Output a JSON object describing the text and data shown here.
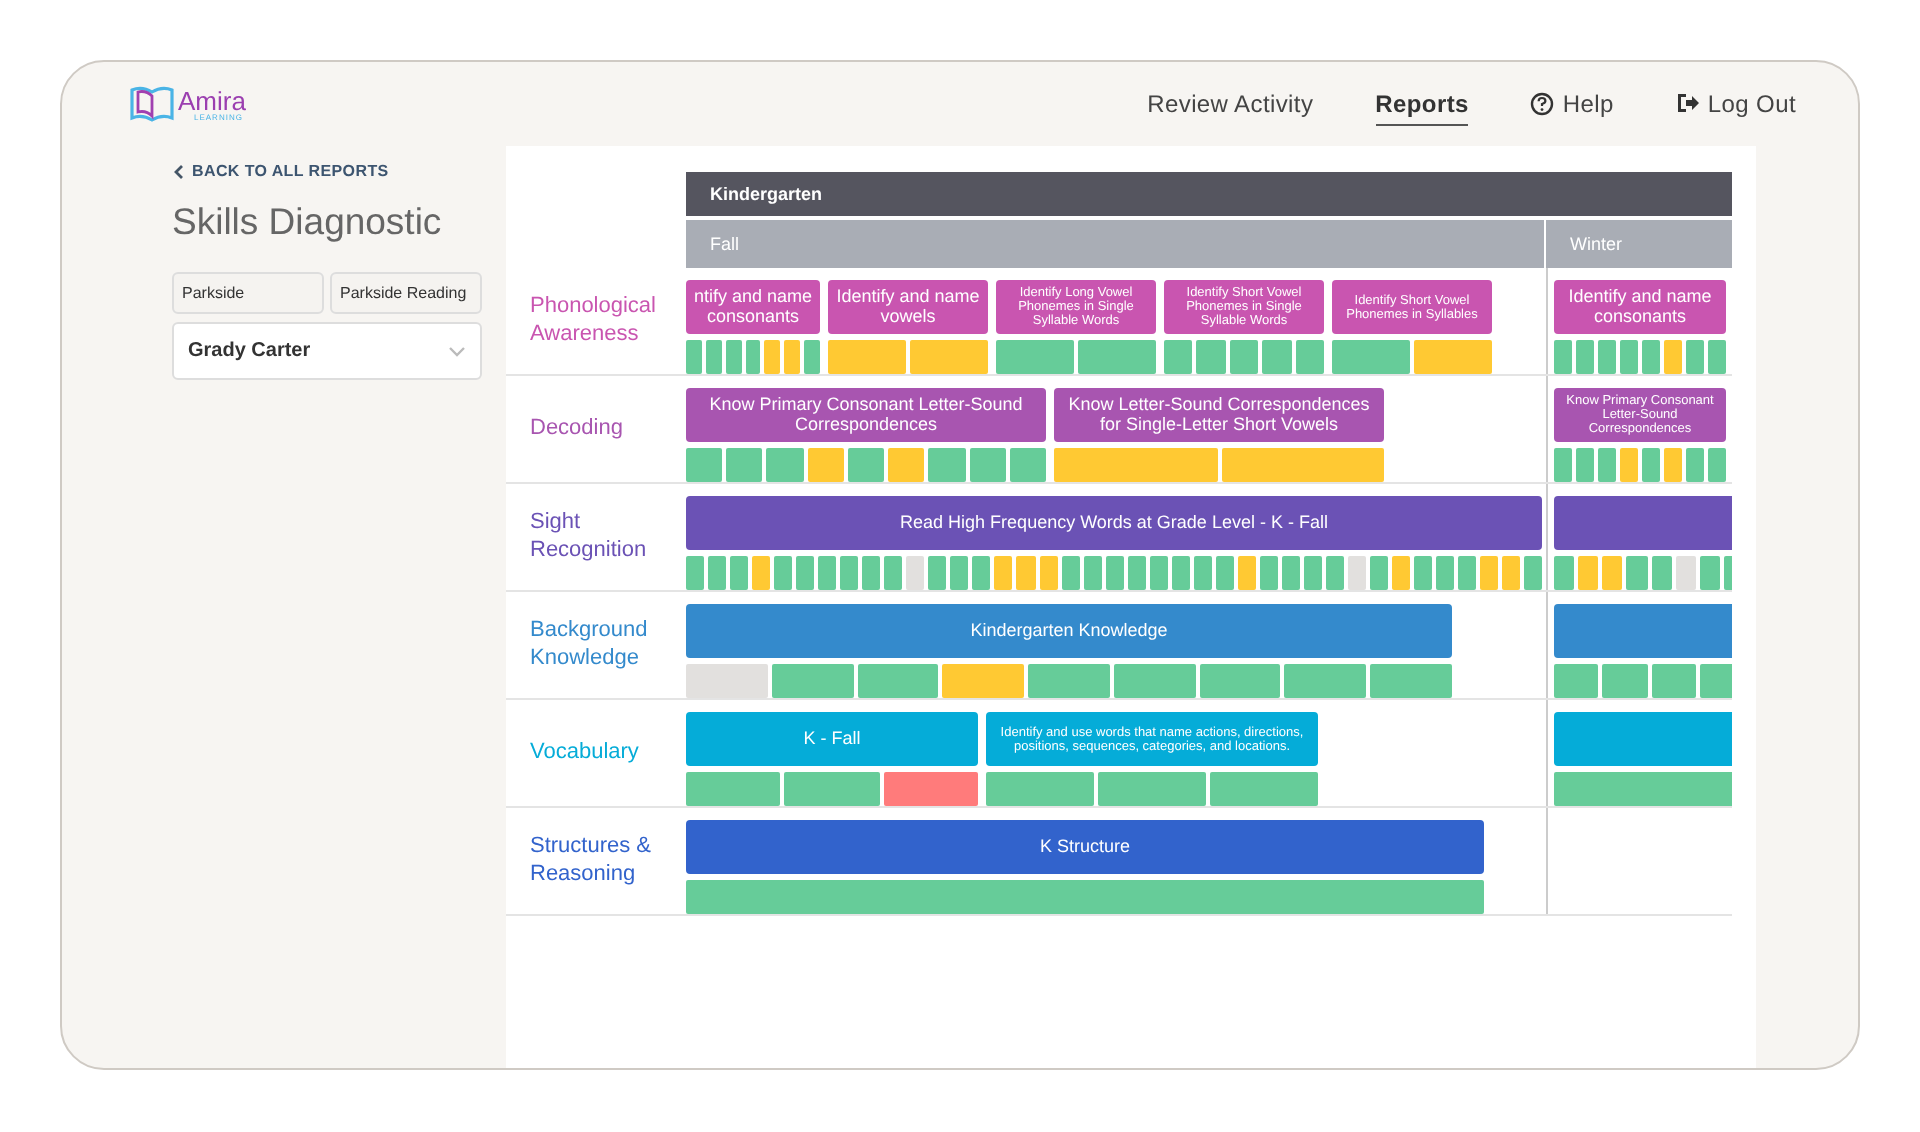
{
  "header": {
    "logo": {
      "name": "Amira",
      "tagline": "LEARNING"
    },
    "nav": [
      {
        "label": "Review Activity",
        "selected": false
      },
      {
        "label": "Reports",
        "selected": true
      },
      {
        "label": "Help",
        "selected": false,
        "kind": "help"
      },
      {
        "label": "Log Out",
        "selected": false,
        "kind": "logout"
      }
    ]
  },
  "sidebar": {
    "back_link": "BACK TO ALL REPORTS",
    "title": "Skills Diagnostic",
    "filters": [
      "Parkside",
      "Parkside Reading"
    ],
    "student_select": {
      "value": "Grady Carter"
    }
  },
  "report": {
    "grade": "Kindergarten",
    "terms": [
      "Fall",
      "Winter"
    ],
    "rows": [
      {
        "label": "Phonological Awareness",
        "color": "#c955b0",
        "fall": [
          {
            "skill": "ntify and name consonants",
            "cells": [
              {
                "kind": "mastered"
              },
              {
                "kind": "mastered"
              },
              {
                "kind": "mastered"
              },
              {
                "kind": "mastered"
              },
              {
                "kind": "developing"
              },
              {
                "kind": "developing"
              },
              {
                "kind": "mastered"
              }
            ]
          },
          {
            "skill": "Identify and name vowels",
            "cells": [
              {
                "kind": "developing"
              },
              {
                "kind": "developing"
              }
            ]
          },
          {
            "skill": "Identify Long Vowel Phonemes in Single Syllable Words",
            "cells": [
              {
                "kind": "mastered"
              },
              {
                "kind": "mastered"
              }
            ]
          },
          {
            "skill": "Identify Short Vowel Phonemes in Single Syllable Words",
            "cells": [
              {
                "kind": "mastered"
              },
              {
                "kind": "mastered"
              },
              {
                "kind": "mastered"
              },
              {
                "kind": "mastered"
              },
              {
                "kind": "mastered"
              }
            ]
          },
          {
            "skill": "Identify Short Vowel Phonemes in Syllables",
            "cells": [
              {
                "kind": "mastered"
              },
              {
                "kind": "developing"
              }
            ]
          }
        ],
        "winter": [
          {
            "skill": "Identify and name consonants",
            "cells": [
              {
                "kind": "mastered"
              },
              {
                "kind": "mastered"
              },
              {
                "kind": "mastered"
              },
              {
                "kind": "mastered"
              },
              {
                "kind": "mastered"
              },
              {
                "kind": "developing"
              },
              {
                "kind": "mastered"
              },
              {
                "kind": "mastered"
              }
            ]
          }
        ]
      },
      {
        "label": "Decoding",
        "color": "#a855b0",
        "fall": [
          {
            "skill": "Know Primary Consonant Letter-Sound Correspondences",
            "cells": [
              {
                "kind": "mastered"
              },
              {
                "kind": "mastered"
              },
              {
                "kind": "mastered"
              },
              {
                "kind": "developing"
              },
              {
                "kind": "mastered"
              },
              {
                "kind": "developing"
              },
              {
                "kind": "mastered"
              },
              {
                "kind": "mastered"
              },
              {
                "kind": "mastered"
              }
            ]
          },
          {
            "skill": "Know Letter-Sound Correspondences for Single-Letter Short Vowels",
            "cells": [
              {
                "kind": "developing"
              },
              {
                "kind": "developing"
              }
            ]
          }
        ],
        "winter": [
          {
            "skill": "Know Primary Consonant Letter-Sound Correspondences",
            "cells": [
              {
                "kind": "mastered"
              },
              {
                "kind": "mastered"
              },
              {
                "kind": "mastered"
              },
              {
                "kind": "developing"
              },
              {
                "kind": "mastered"
              },
              {
                "kind": "developing"
              },
              {
                "kind": "mastered"
              },
              {
                "kind": "mastered"
              }
            ]
          }
        ]
      },
      {
        "label": "Sight Recognition",
        "color": "#6b52b5",
        "fall": [
          {
            "skill": "Read High Frequency Words at Grade Level - K - Fall",
            "cells": [
              {
                "kind": "mastered"
              },
              {
                "kind": "mastered"
              },
              {
                "kind": "mastered"
              },
              {
                "kind": "developing"
              },
              {
                "kind": "mastered"
              },
              {
                "kind": "mastered"
              },
              {
                "kind": "mastered"
              },
              {
                "kind": "mastered"
              },
              {
                "kind": "mastered"
              },
              {
                "kind": "mastered"
              },
              {
                "kind": "not_assessed"
              },
              {
                "kind": "mastered"
              },
              {
                "kind": "mastered"
              },
              {
                "kind": "mastered"
              },
              {
                "kind": "developing"
              },
              {
                "kind": "developing"
              },
              {
                "kind": "developing"
              },
              {
                "kind": "mastered"
              },
              {
                "kind": "mastered"
              },
              {
                "kind": "mastered"
              },
              {
                "kind": "mastered"
              },
              {
                "kind": "mastered"
              },
              {
                "kind": "mastered"
              },
              {
                "kind": "mastered"
              },
              {
                "kind": "mastered"
              },
              {
                "kind": "developing"
              },
              {
                "kind": "mastered"
              },
              {
                "kind": "mastered"
              },
              {
                "kind": "mastered"
              },
              {
                "kind": "mastered"
              },
              {
                "kind": "not_assessed"
              },
              {
                "kind": "mastered"
              },
              {
                "kind": "developing"
              },
              {
                "kind": "mastered"
              },
              {
                "kind": "mastered"
              },
              {
                "kind": "mastered"
              },
              {
                "kind": "developing"
              },
              {
                "kind": "developing"
              },
              {
                "kind": "mastered"
              }
            ]
          }
        ],
        "winter": [
          {
            "cells": [
              {
                "kind": "mastered"
              },
              {
                "kind": "developing"
              },
              {
                "kind": "developing"
              },
              {
                "kind": "mastered"
              },
              {
                "kind": "mastered"
              },
              {
                "kind": "not_assessed"
              },
              {
                "kind": "mastered"
              },
              {
                "kind": "mastered"
              }
            ]
          }
        ]
      },
      {
        "label": "Background Knowledge",
        "color": "#348acc",
        "fall": [
          {
            "skill": "Kindergarten Knowledge",
            "cells": [
              {
                "kind": "not_assessed"
              },
              {
                "kind": "mastered"
              },
              {
                "kind": "mastered"
              },
              {
                "kind": "developing"
              },
              {
                "kind": "mastered"
              },
              {
                "kind": "mastered"
              },
              {
                "kind": "mastered"
              },
              {
                "kind": "mastered"
              },
              {
                "kind": "mastered"
              }
            ]
          }
        ],
        "winter": [
          {
            "cells": [
              {
                "kind": "mastered"
              },
              {
                "kind": "mastered"
              },
              {
                "kind": "mastered"
              },
              {
                "kind": "mastered"
              }
            ]
          }
        ]
      },
      {
        "label": "Vocabulary",
        "color": "#05acd8",
        "fall": [
          {
            "skill": "K - Fall",
            "cells": [
              {
                "kind": "mastered"
              },
              {
                "kind": "mastered"
              },
              {
                "kind": "struggling"
              }
            ]
          },
          {
            "skill": "Identify and use words that name actions, directions, positions, sequences, categories, and locations.",
            "cells": [
              {
                "kind": "mastered"
              },
              {
                "kind": "mastered"
              },
              {
                "kind": "mastered"
              }
            ]
          }
        ],
        "winter": [
          {
            "cells": [
              {
                "kind": "mastered"
              }
            ]
          }
        ]
      },
      {
        "label": "Structures & Reasoning",
        "color": "#3263cc",
        "fall": [
          {
            "skill": "K Structure",
            "cells": [
              {
                "kind": "mastered"
              }
            ]
          }
        ],
        "winter": []
      }
    ]
  }
}
